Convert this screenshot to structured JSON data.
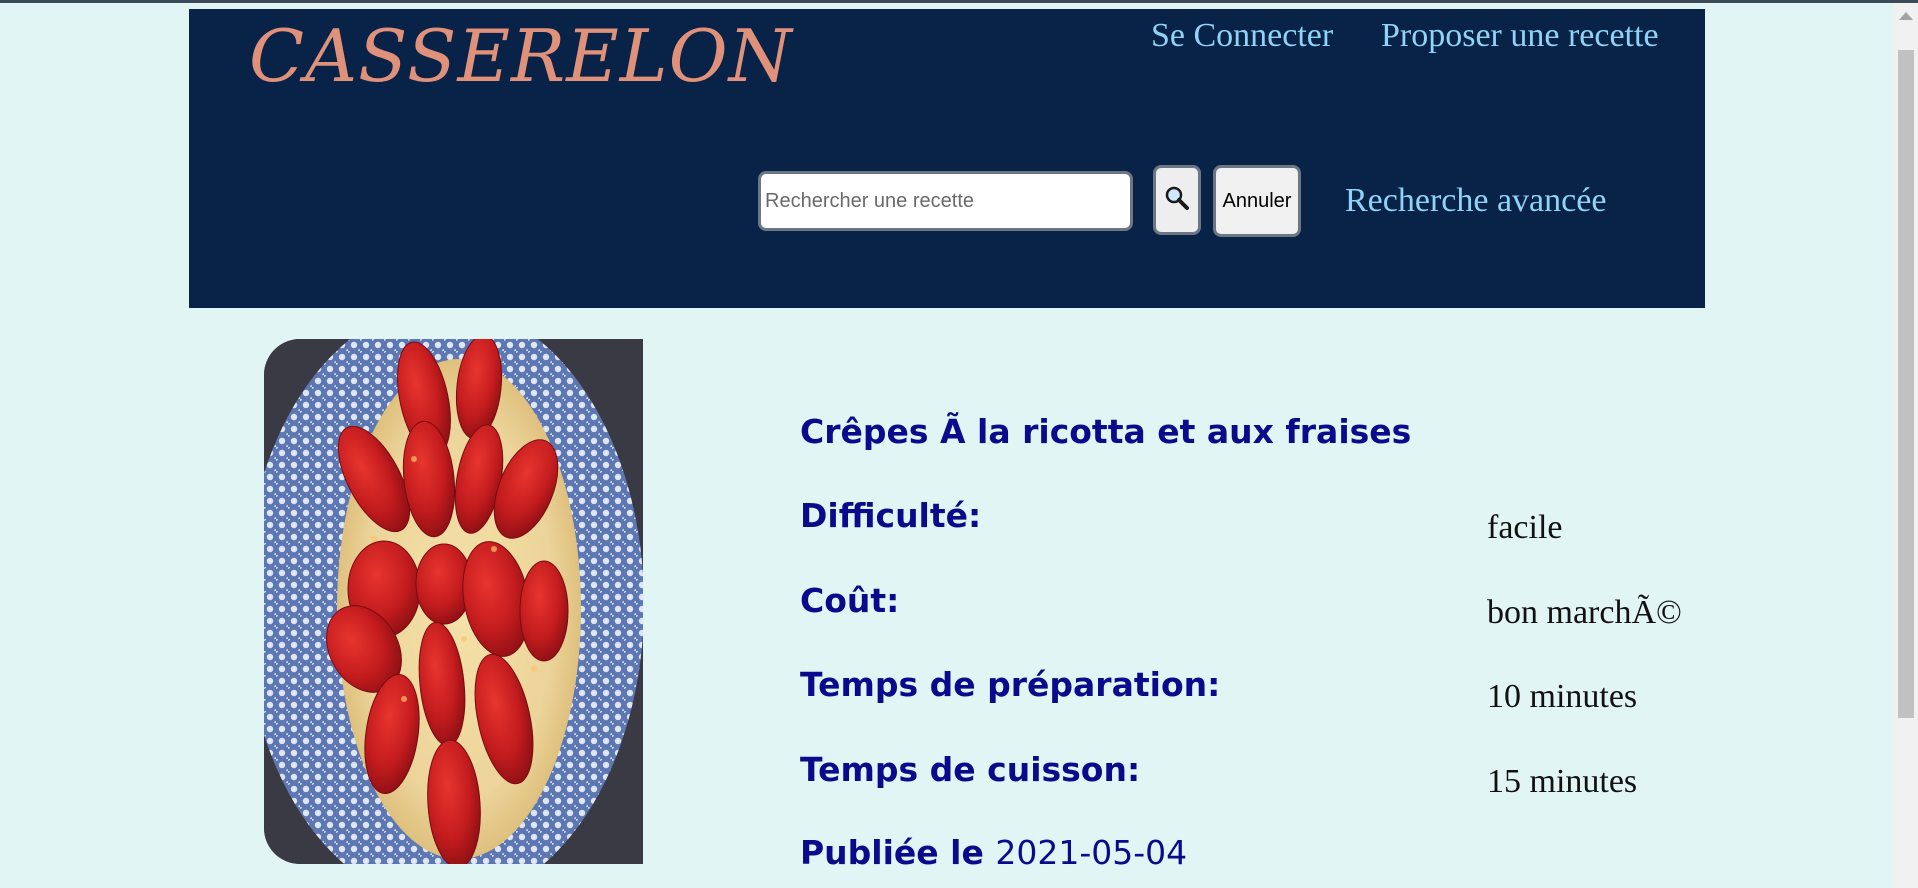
{
  "header": {
    "logo": "CASSERELON",
    "nav": {
      "login": "Se Connecter",
      "propose": "Proposer une recette"
    },
    "search": {
      "placeholder": "Rechercher une recette",
      "cancel_label": "Annuler",
      "advanced_label": "Recherche avancée"
    },
    "search_icon": "magnifier-icon"
  },
  "recipe": {
    "title": "Crêpes Ã  la ricotta et aux fraises",
    "image_alt": "crepe with ricotta and strawberries on a blue plate",
    "fields": [
      {
        "label": "Difficulté:",
        "value": "facile"
      },
      {
        "label": "Coût:",
        "value": "bon marchÃ©"
      },
      {
        "label": "Temps de préparation:",
        "value": "10 minutes"
      },
      {
        "label": "Temps de cuisson:",
        "value": "15 minutes"
      }
    ],
    "published_label": "Publiée le",
    "published_date": "2021-05-04"
  },
  "colors": {
    "page_bg": "#e2f5f5",
    "header_bg": "#082347",
    "logo": "#e0917a",
    "nav_link": "#8fd3f7",
    "label": "#0a0a8c"
  }
}
